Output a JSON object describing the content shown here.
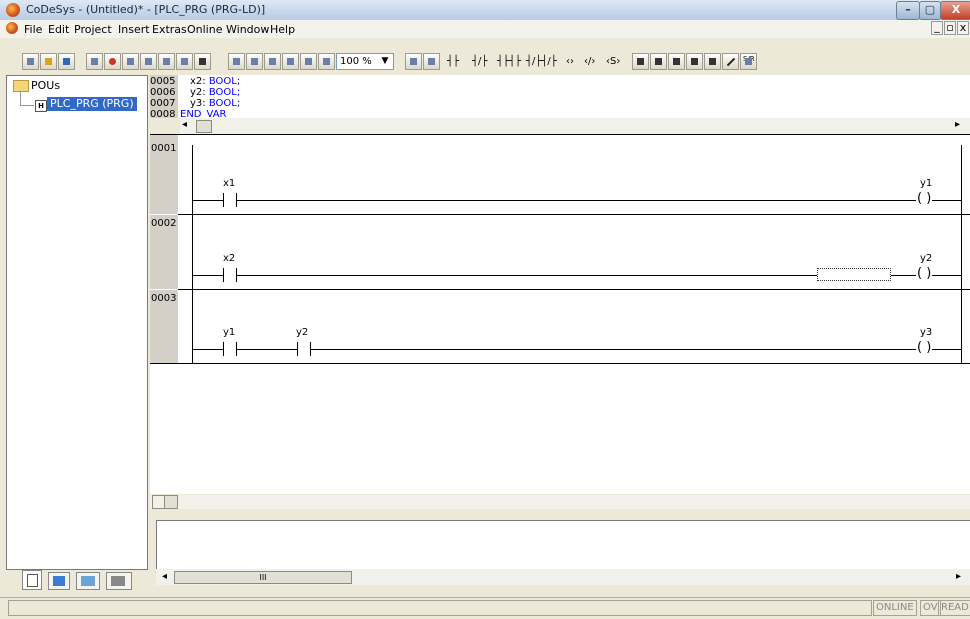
{
  "window": {
    "title": "CoDeSys - (Untitled)* - [PLC_PRG (PRG-LD)]",
    "minimize": "–",
    "maximize": "▢",
    "close": "X"
  },
  "menu": {
    "items": [
      "File",
      "Edit",
      "Project",
      "Insert",
      "Extras",
      "Online",
      "Window",
      "Help"
    ],
    "mdi_min": "_",
    "mdi_restore": "▫",
    "mdi_close": "x"
  },
  "toolbar": {
    "zoom": "100 %",
    "zoom_arrow": "▼",
    "ld_tools": [
      "┤├",
      "┤/├",
      "┤├┤├",
      "┤/├┤/├",
      "‹›",
      "‹/›",
      "‹S›"
    ],
    "set_reset": "S/R"
  },
  "tree": {
    "root": "POUs",
    "prg": "PLC_PRG (PRG)",
    "prg_icon": "H"
  },
  "declaration": {
    "lines": [
      {
        "num": "0005",
        "name": "x2",
        "type": "BOOL;"
      },
      {
        "num": "0006",
        "name": "y2",
        "type": "BOOL;"
      },
      {
        "num": "0007",
        "name": "y3",
        "type": "BOOL;"
      },
      {
        "num": "0008",
        "text": "END_VAR"
      }
    ],
    "scroll_left": "◂",
    "scroll_right": "▸"
  },
  "rungs": [
    {
      "num": "0001",
      "contacts": [
        "x1"
      ],
      "coil": "y1"
    },
    {
      "num": "0002",
      "contacts": [
        "x2"
      ],
      "coil": "y2"
    },
    {
      "num": "0003",
      "contacts": [
        "y1",
        "y2"
      ],
      "coil": "y3"
    }
  ],
  "coil_symbol": "( )",
  "messages": {
    "scroll_left": "◂",
    "scroll_right": "▸",
    "thumb": "III"
  },
  "status": {
    "online": "ONLINE",
    "ov": "OV",
    "read": "READ"
  },
  "colors": {
    "selection": "#316ac5",
    "declaration_type": "#0000ff",
    "gutter": "#d4d0c8"
  }
}
